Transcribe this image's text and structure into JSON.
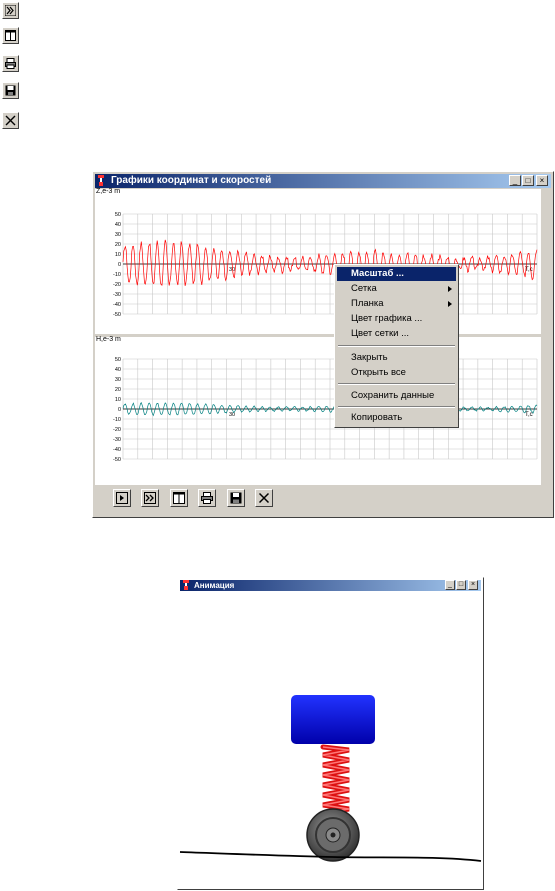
{
  "graph_window": {
    "title": "Графики координат и скоростей",
    "top_plot": {
      "ylabel": "Z,e-3 m",
      "xlabel": "T,c",
      "yticks": [
        "50",
        "40",
        "30",
        "20",
        "10",
        "0",
        "-10",
        "-20",
        "-30",
        "-40",
        "-50"
      ],
      "xtick": "30",
      "line_color": "#ff0000"
    },
    "bottom_plot": {
      "ylabel": "H,e-3 m",
      "xlabel": "T,c",
      "yticks": [
        "50",
        "40",
        "30",
        "20",
        "10",
        "0",
        "-10",
        "-20",
        "-30",
        "-40",
        "-50"
      ],
      "xtick": "30",
      "line_color": "#008080"
    },
    "toolbar_icons": [
      "play-icon",
      "fast-forward-icon",
      "columns-icon",
      "print-icon",
      "save-icon",
      "close-icon"
    ]
  },
  "context_menu": {
    "items": [
      {
        "label": "Масштаб ...",
        "selected": true
      },
      {
        "label": "Сетка",
        "submenu": true
      },
      {
        "label": "Планка",
        "submenu": true
      },
      {
        "label": "Цвет графика ..."
      },
      {
        "label": "Цвет сетки ..."
      },
      {
        "label": "Закрыть"
      },
      {
        "label": "Открыть все"
      },
      {
        "label": "Сохранить данные"
      },
      {
        "label": "Копировать"
      }
    ]
  },
  "animation_window": {
    "title": "Анимация",
    "colors": {
      "body": "#0000cc",
      "spring": "#dd1111",
      "wheel": "#555555"
    }
  },
  "left_toolbar_icons": [
    "fast-forward-icon",
    "columns-icon",
    "print-icon",
    "save-icon",
    "close-icon"
  ]
}
